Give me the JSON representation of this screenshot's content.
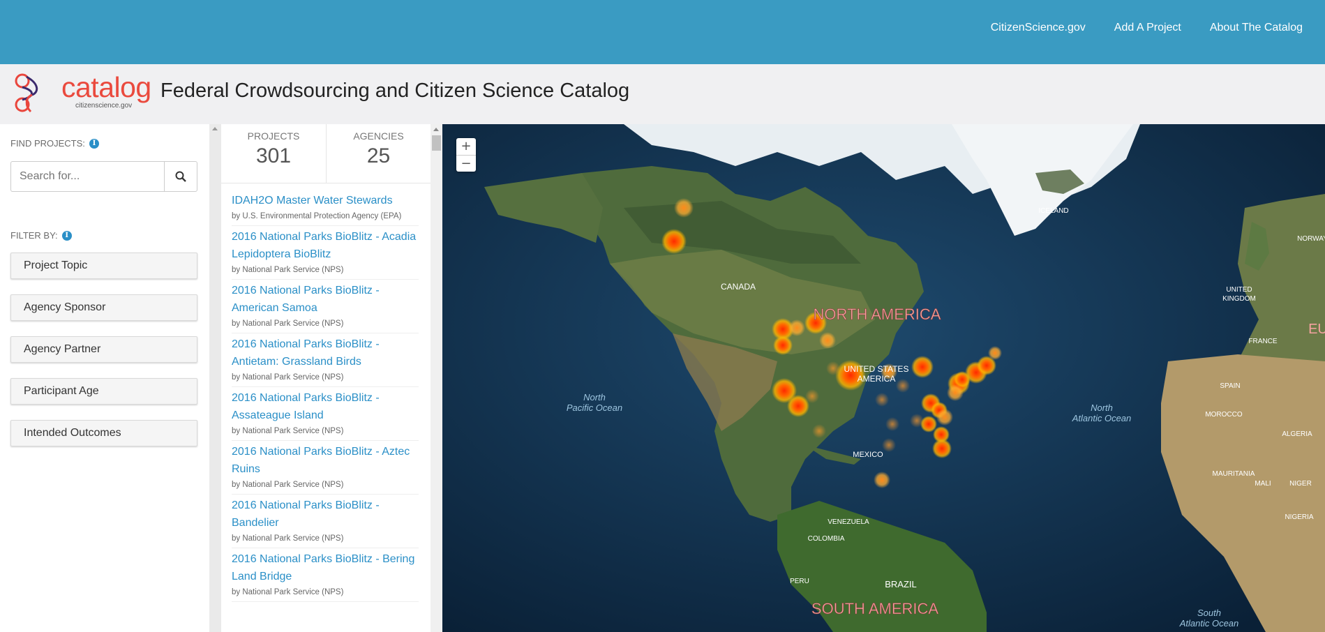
{
  "topnav": {
    "links": [
      "CitizenScience.gov",
      "Add A Project",
      "About The Catalog"
    ]
  },
  "header": {
    "logo_word": "catalog",
    "logo_sub": "citizenscience.gov",
    "title": "Federal Crowdsourcing and Citizen Science Catalog"
  },
  "sidebar": {
    "find_label": "FIND PROJECTS:",
    "search_placeholder": "Search for...",
    "filter_label": "FILTER BY:",
    "filters": [
      "Project Topic",
      "Agency Sponsor",
      "Agency Partner",
      "Participant Age",
      "Intended Outcomes"
    ]
  },
  "stats": {
    "projects_label": "PROJECTS",
    "projects_value": "301",
    "agencies_label": "AGENCIES",
    "agencies_value": "25"
  },
  "projects": [
    {
      "title": "IDAH2O Master Water Stewards",
      "by": "by U.S. Environmental Protection Agency (EPA)"
    },
    {
      "title": "2016 National Parks BioBlitz - Acadia Lepidoptera BioBlitz",
      "by": "by National Park Service (NPS)"
    },
    {
      "title": "2016 National Parks BioBlitz - American Samoa",
      "by": "by National Park Service (NPS)"
    },
    {
      "title": "2016 National Parks BioBlitz - Antietam: Grassland Birds",
      "by": "by National Park Service (NPS)"
    },
    {
      "title": "2016 National Parks BioBlitz - Assateague Island",
      "by": "by National Park Service (NPS)"
    },
    {
      "title": "2016 National Parks BioBlitz - Aztec Ruins",
      "by": "by National Park Service (NPS)"
    },
    {
      "title": "2016 National Parks BioBlitz - Bandelier",
      "by": "by National Park Service (NPS)"
    },
    {
      "title": "2016 National Parks BioBlitz - Bering Land Bridge",
      "by": "by National Park Service (NPS)"
    }
  ],
  "map": {
    "zoom_in": "+",
    "zoom_out": "−",
    "labels": {
      "north_america": "NORTH AMERICA",
      "south_america": "SOUTH AMERICA",
      "canada": "CANADA",
      "usa_1": "UNITED STATES",
      "usa_2": "AMERICA",
      "mexico": "MEXICO",
      "iceland": "ICELAND",
      "norway": "NORWAY",
      "uk_1": "UNITED",
      "uk_2": "KINGDOM",
      "france": "FRANCE",
      "spain": "SPAIN",
      "morocco": "MOROCCO",
      "algeria": "ALGERIA",
      "mauritania": "MAURITANIA",
      "mali": "MALI",
      "niger": "NIGER",
      "nigeria": "NIGERIA",
      "venezuela": "VENEZUELA",
      "colombia": "COLOMBIA",
      "peru": "PERU",
      "brazil": "BRAZIL",
      "eu": "EU",
      "npo_1": "North",
      "npo_2": "Pacific Ocean",
      "nao_1": "North",
      "nao_2": "Atlantic Ocean",
      "sao_1": "South",
      "sao_2": "Atlantic Ocean"
    }
  }
}
